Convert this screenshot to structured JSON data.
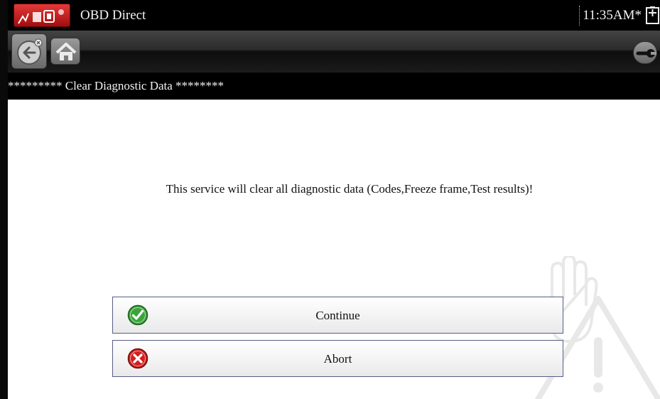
{
  "titlebar": {
    "app_title": "OBD Direct",
    "time": "11:35AM*",
    "app_icon": "car-toolbox-icon",
    "battery_icon": "battery-icon"
  },
  "toolbar": {
    "back_icon": "back-arrow-icon",
    "home_icon": "home-icon",
    "tools_icon": "wrench-icon"
  },
  "header": {
    "title": "********* Clear Diagnostic Data ********"
  },
  "main": {
    "message": "This service will clear all diagnostic data (Codes,Freeze frame,Test results)!",
    "watermark_icon": "warning-hand-icon"
  },
  "actions": [
    {
      "label": "Continue",
      "icon": "check-circle-icon",
      "color": "#3ca33c"
    },
    {
      "label": "Abort",
      "icon": "x-circle-icon",
      "color": "#d22020"
    }
  ],
  "colors": {
    "titlebar_bg": "#000000",
    "button_border": "#555e87",
    "app_icon_red": "#c41e1e"
  }
}
